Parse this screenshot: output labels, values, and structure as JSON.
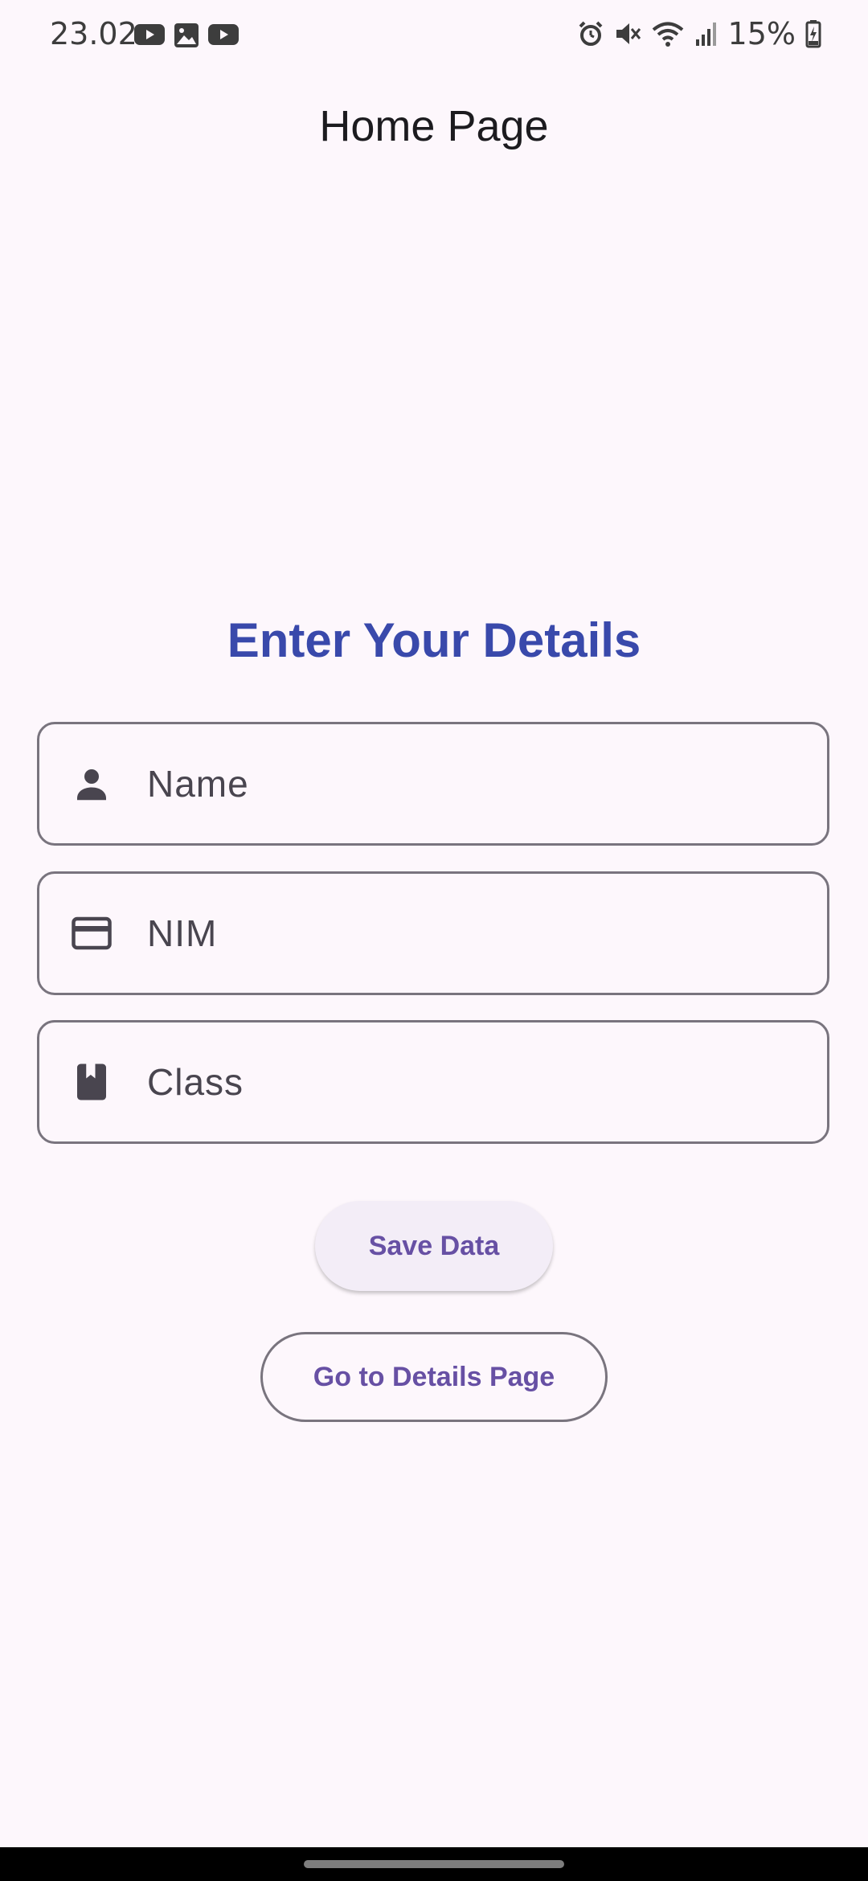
{
  "status_bar": {
    "time": "23.02",
    "battery": "15%",
    "left_icons": [
      "youtube-icon",
      "gallery-icon",
      "youtube-icon"
    ],
    "right_icons": [
      "alarm-icon",
      "mute-icon",
      "wifi-icon",
      "signal-icon",
      "battery-icon"
    ]
  },
  "app_bar": {
    "title": "Home Page"
  },
  "form": {
    "heading": "Enter Your Details",
    "fields": [
      {
        "label": "Name",
        "icon": "person-icon"
      },
      {
        "label": "NIM",
        "icon": "credit-card-icon"
      },
      {
        "label": "Class",
        "icon": "book-icon"
      }
    ]
  },
  "buttons": {
    "save": "Save Data",
    "details": "Go to Details Page"
  },
  "colors": {
    "background": "#fdf7fc",
    "heading": "#3949ab",
    "primary": "#6750a4",
    "outline": "#79747e",
    "icon": "#49454f"
  }
}
